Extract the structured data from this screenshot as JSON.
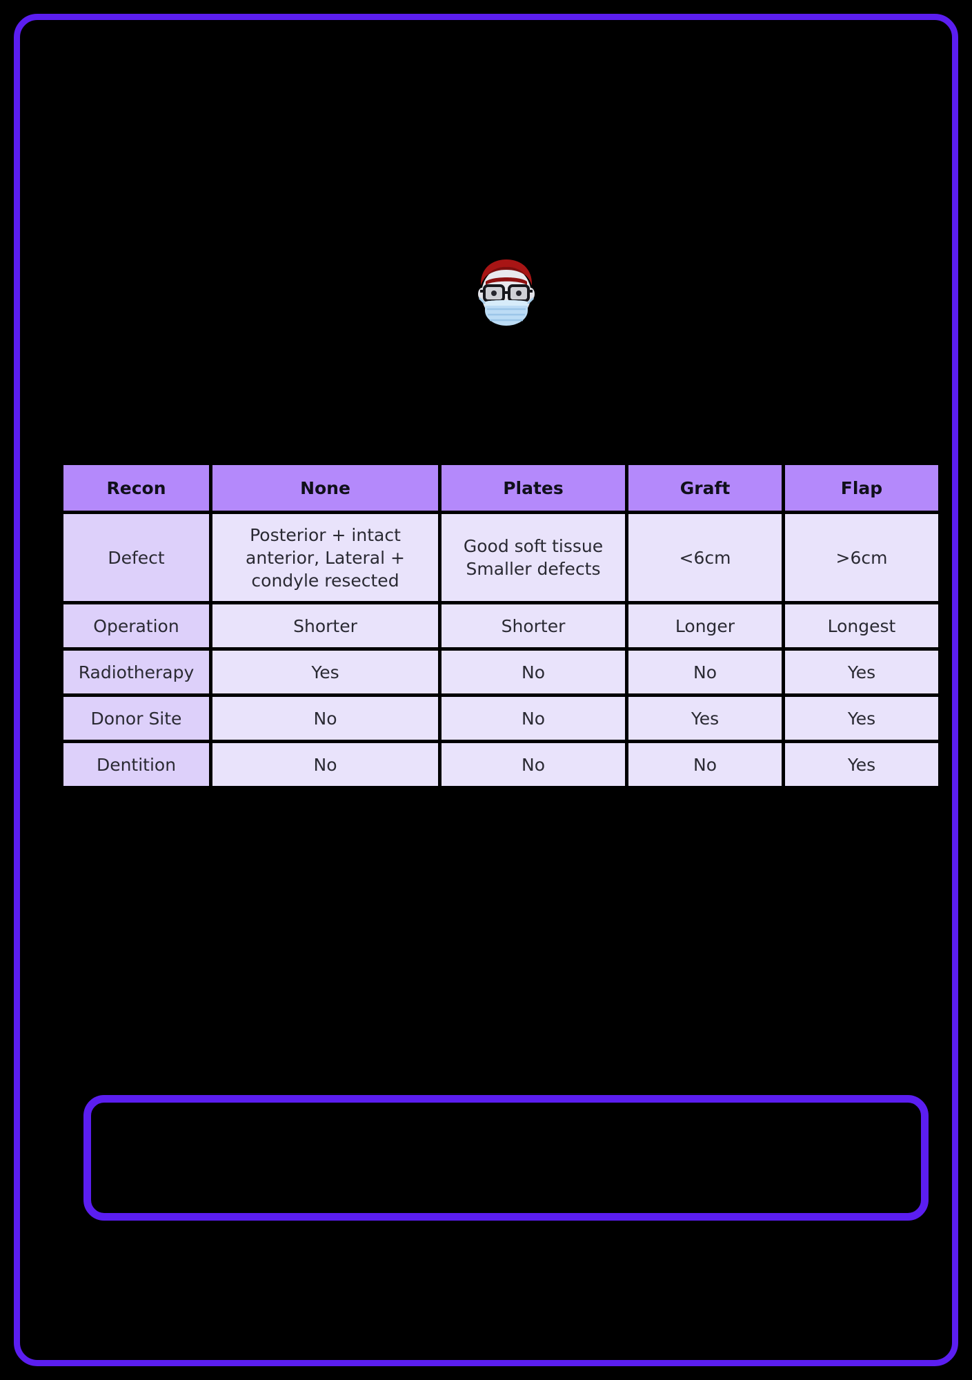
{
  "slide": {
    "background_color": "#000000",
    "border_color": "#5b1ef0"
  },
  "avatar": {
    "icon": "person-with-mask-and-glasses-avatar",
    "hair_color": "#9e1313",
    "mask_color": "#bcdcf5",
    "skin_color": "#e8e8ec",
    "glasses_color": "#1a1a1a"
  },
  "table": {
    "header_bg": "#b489fb",
    "cell_bg": "#e9e3fb",
    "rowhead_bg": "#ddd0fa",
    "columns": [
      "Recon",
      "None",
      "Plates",
      "Graft",
      "Flap"
    ],
    "rows": [
      {
        "label": "Defect",
        "cells": [
          [
            "Posterior + intact",
            "anterior, Lateral +",
            "condyle resected"
          ],
          [
            "Good soft tissue",
            "Smaller defects"
          ],
          [
            "<6cm"
          ],
          [
            ">6cm"
          ]
        ]
      },
      {
        "label": "Operation",
        "cells": [
          [
            "Shorter"
          ],
          [
            "Shorter"
          ],
          [
            "Longer"
          ],
          [
            "Longest"
          ]
        ]
      },
      {
        "label": "Radiotherapy",
        "cells": [
          [
            "Yes"
          ],
          [
            "No"
          ],
          [
            "No"
          ],
          [
            "Yes"
          ]
        ]
      },
      {
        "label": "Donor Site",
        "cells": [
          [
            "No"
          ],
          [
            "No"
          ],
          [
            "Yes"
          ],
          [
            "Yes"
          ]
        ]
      },
      {
        "label": "Dentition",
        "cells": [
          [
            "No"
          ],
          [
            "No"
          ],
          [
            "No"
          ],
          [
            "Yes"
          ]
        ]
      }
    ]
  },
  "bottom_box": {
    "border_color": "#5b1ef0",
    "content": ""
  }
}
